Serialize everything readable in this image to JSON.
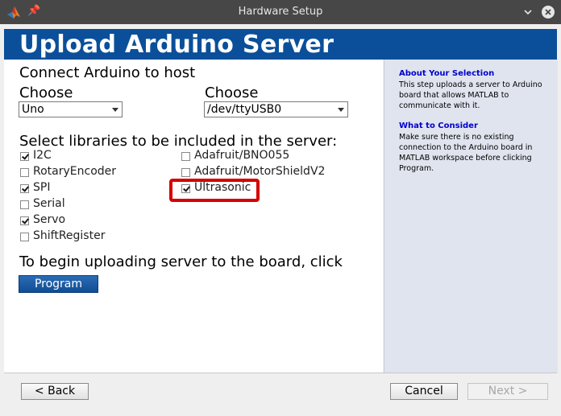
{
  "window": {
    "title": "Hardware Setup"
  },
  "banner": {
    "title": "Upload Arduino Server"
  },
  "connect": {
    "heading": "Connect Arduino to host",
    "board_label": "Choose",
    "board_value": "Uno",
    "port_label": "Choose",
    "port_value": "/dev/ttyUSB0"
  },
  "libraries": {
    "heading": "Select libraries to be included in the server:",
    "items": [
      {
        "label": "I2C",
        "checked": true
      },
      {
        "label": "RotaryEncoder",
        "checked": false
      },
      {
        "label": "SPI",
        "checked": true
      },
      {
        "label": "Serial",
        "checked": false
      },
      {
        "label": "Servo",
        "checked": true
      },
      {
        "label": "ShiftRegister",
        "checked": false
      },
      {
        "label": "Adafruit/BNO055",
        "checked": false
      },
      {
        "label": "Adafruit/MotorShieldV2",
        "checked": false
      },
      {
        "label": "Ultrasonic",
        "checked": true
      }
    ]
  },
  "upload": {
    "instruction": "To begin uploading server to the board, click",
    "program_label": "Program"
  },
  "side": {
    "about_title": "About Your Selection",
    "about_text": "This step uploads a server to Arduino board that allows MATLAB to communicate with it.",
    "consider_title": "What to Consider",
    "consider_text": "Make sure there is no existing connection to the Arduino board in MATLAB workspace before clicking Program."
  },
  "footer": {
    "back_label": "< Back",
    "cancel_label": "Cancel",
    "next_label": "Next >"
  },
  "colors": {
    "banner": "#0b4f9a",
    "highlight": "#d50000",
    "link": "#0000cc"
  }
}
